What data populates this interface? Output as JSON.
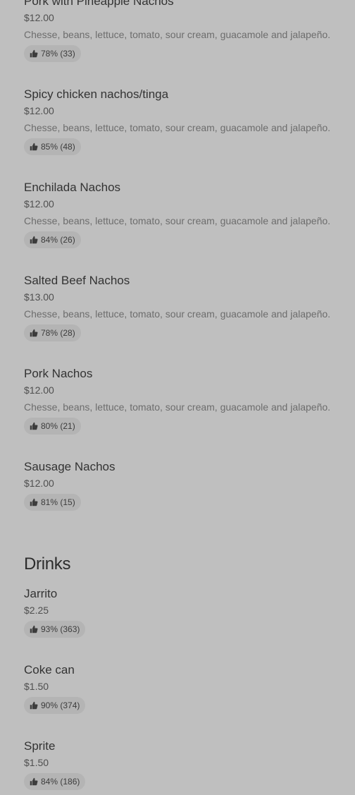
{
  "nachos_items": [
    {
      "name": "Pork with Pineapple Nachos",
      "price": "$12.00",
      "description": "Chesse, beans, lettuce, tomato, sour cream, guacamole and jalapeño.",
      "rating": "78% (33)"
    },
    {
      "name": "Spicy chicken nachos/tinga",
      "price": "$12.00",
      "description": "Chesse, beans, lettuce, tomato, sour cream, guacamole and jalapeño.",
      "rating": "85% (48)"
    },
    {
      "name": "Enchilada Nachos",
      "price": "$12.00",
      "description": "Chesse, beans, lettuce, tomato, sour cream, guacamole and jalapeño.",
      "rating": "84% (26)"
    },
    {
      "name": "Salted Beef Nachos",
      "price": "$13.00",
      "description": "Chesse, beans, lettuce, tomato, sour cream, guacamole and jalapeño.",
      "rating": "78% (28)"
    },
    {
      "name": "Pork Nachos",
      "price": "$12.00",
      "description": "Chesse, beans, lettuce, tomato, sour cream, guacamole and jalapeño.",
      "rating": "80% (21)"
    },
    {
      "name": "Sausage Nachos",
      "price": "$12.00",
      "rating": "81% (15)"
    }
  ],
  "drinks_section": {
    "title": "Drinks",
    "items": [
      {
        "name": "Jarrito",
        "price": "$2.25",
        "rating": "93% (363)"
      },
      {
        "name": "Coke can",
        "price": "$1.50",
        "rating": "90% (374)"
      },
      {
        "name": "Sprite",
        "price": "$1.50",
        "rating": "84% (186)"
      }
    ]
  },
  "icons": {
    "rating": "thumbs-up-icon"
  },
  "colors": {
    "background": "#bfbfbf",
    "rating_pill": "#b4b4b4"
  }
}
